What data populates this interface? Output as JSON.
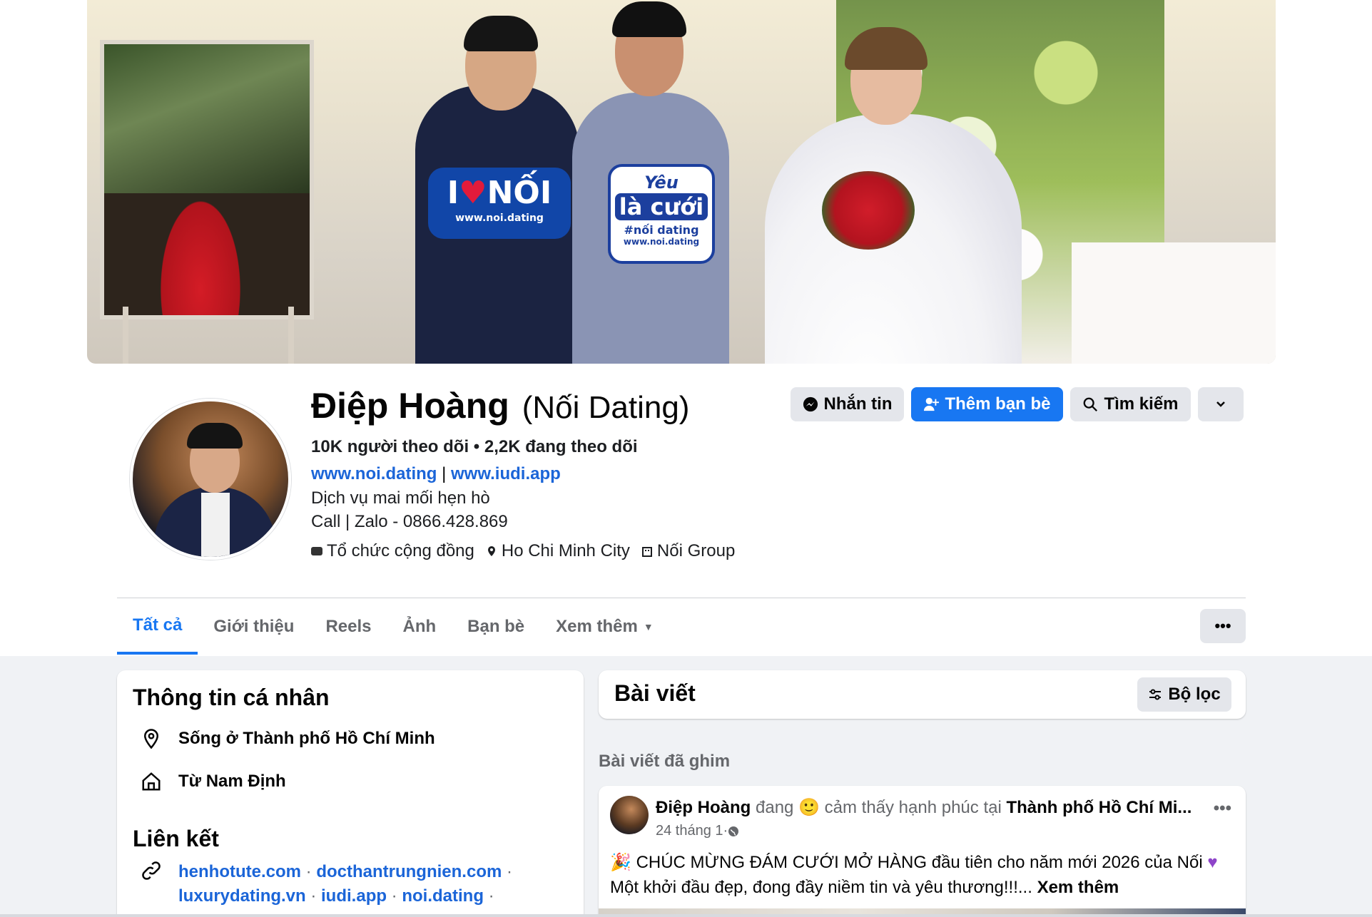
{
  "profile": {
    "name": "Điệp Hoàng",
    "alt_name": "(Nối Dating)",
    "followers": "10K người theo dõi",
    "dot": "•",
    "following": "2,2K đang theo dõi",
    "link1": "www.noi.dating",
    "separator": "|",
    "link2": "www.iudi.app",
    "bio_line1": "Dịch vụ mai mối hẹn hò",
    "bio_line2": "Call | Zalo - 0866.428.869",
    "category": "Tổ chức cộng đồng",
    "location": "Ho Chi Minh City",
    "group": "Nối Group"
  },
  "actions": {
    "message": "Nhắn tin",
    "add_friend": "Thêm bạn bè",
    "search": "Tìm kiếm"
  },
  "cover": {
    "sign1_text": "I",
    "sign1_word": "NỐI",
    "sign1_url": "www.noi.dating",
    "sign2_line1": "Yêu",
    "sign2_line2": "là cưới",
    "sign2_line3": "#nối dating",
    "sign2_url": "www.noi.dating"
  },
  "tabs": [
    {
      "label": "Tất cả"
    },
    {
      "label": "Giới thiệu"
    },
    {
      "label": "Reels"
    },
    {
      "label": "Ảnh"
    },
    {
      "label": "Bạn bè"
    },
    {
      "label": "Xem thêm"
    }
  ],
  "more_button": "•••",
  "intro": {
    "title": "Thông tin cá nhân",
    "lives": "Sống ở Thành phố Hồ Chí Minh",
    "from": "Từ Nam Định",
    "links_title": "Liên kết",
    "links": [
      "henhotute.com",
      "docthantrungnien.com",
      "luxurydating.vn",
      "iudi.app",
      "noi.dating"
    ],
    "link_sep": " · "
  },
  "posts": {
    "title": "Bài viết",
    "filter": "Bộ lọc",
    "pinned_label": "Bài viết đã ghim"
  },
  "post": {
    "author": "Điệp Hoàng",
    "feeling_prefix": " đang ",
    "feeling_text": "cảm thấy hạnh phúc tại ",
    "place": "Thành phố Hồ Chí Mi...",
    "date": "24 tháng 1",
    "date_sep": " · ",
    "more": "•••",
    "body_line1": "CHÚC MỪNG ĐÁM CƯỚI MỞ HÀNG đầu tiên cho năm mới 2026 của Nối",
    "body_line2": "Một khởi đầu đẹp, đong đầy niềm tin và yêu thương!!!...",
    "see_more": "Xem thêm"
  },
  "colors": {
    "accent": "#1877f2",
    "link": "#1b65d8",
    "secondary_text": "#65676b",
    "page_bg": "#f0f2f5"
  }
}
